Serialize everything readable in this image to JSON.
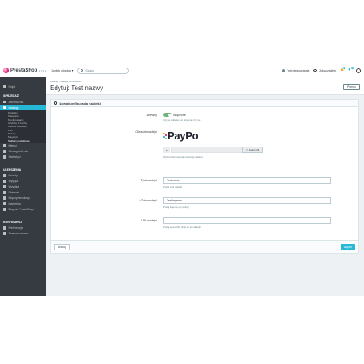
{
  "header": {
    "brand": "PrestaShop",
    "version": "1.7.6.x",
    "quick_access": "Szybki dostęp ▾",
    "search_placeholder": "Szukaj",
    "debug_mode": "Tryb debugowania",
    "view_store": "Zobacz sklep",
    "notif_orders": "0",
    "notif_customers": "1"
  },
  "sidebar": {
    "home": "Pulpit",
    "sell_section": "SPRZEDAŻ",
    "orders": "Zamówienia",
    "catalog": "Katalog",
    "catalog_sub": [
      "Produkty",
      "Kategorie",
      "Monitorowanie",
      "Atrybuty & Cechy",
      "Marki & Dostawcy",
      "Pliki",
      "Rabaty",
      "Magazyn",
      "Naklejki produktowe"
    ],
    "customers": "Klienci",
    "customer_service": "Obsługa klienta",
    "stats": "Statystyki",
    "improve_section": "ULEPSZENIA",
    "modules": "Moduły",
    "design": "Wygląd",
    "shipping": "Wysyłka",
    "payment": "Płatność",
    "international": "Międzynarodowy",
    "marketing": "Marketing",
    "blog": "Blog do PrestaShop",
    "configure_section": "KONFIGURUJ",
    "settings": "Preferencje",
    "advanced": "Zaawansowane"
  },
  "page": {
    "breadcrumb": "Katalog  /  Naklejki produktowe",
    "title": "Edytuj: Test nazwy",
    "help_button": "Pomoc"
  },
  "form": {
    "panel_title": "Nowa konfiguracja naklejki",
    "active_label": "Aktywny",
    "active_value": "Włączone",
    "active_hint": "Czy ta naklejka jest aktywna, czy nie",
    "image_label": "Obrazek naklejki",
    "image_brand": "PayPo",
    "file_button": "Dodaj plik",
    "image_hint": "Wybierz obrazek jako ilustrację naklejki",
    "name_label": "* Tytuł naklejki",
    "name_value": "Test nazwy",
    "name_hint": "Podaj tytuł naklejki",
    "desc_label": "* Opis naklejki",
    "desc_value": "Test legenia",
    "desc_hint": "Podaj legendę tej naklejki",
    "url_label": "URL naklejki",
    "url_value": "",
    "url_hint": "Podaj adres URL (link) do tej naklejki",
    "cancel_button": "Anuluj",
    "save_button": "Zapisz"
  },
  "colors": {
    "accent": "#25b9d7",
    "sidebar": "#363a41",
    "toggle_on": "#70b580",
    "brand_pink": "#df0067"
  }
}
